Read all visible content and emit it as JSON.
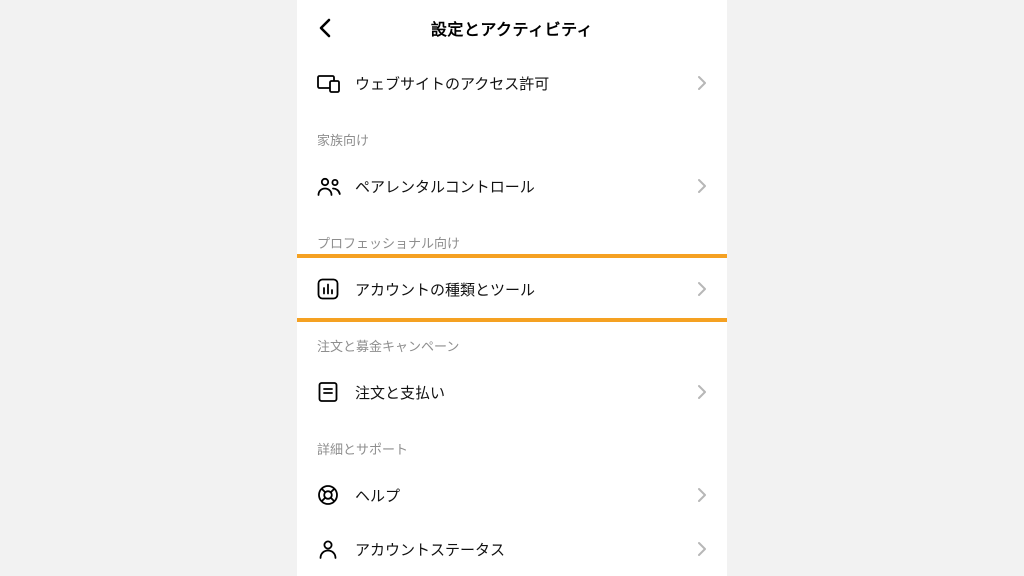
{
  "header": {
    "title": "設定とアクティビティ"
  },
  "rows": {
    "website_permissions": "ウェブサイトのアクセス許可",
    "parental_controls": "ペアレンタルコントロール",
    "account_types_tools": "アカウントの種類とツール",
    "orders_payments": "注文と支払い",
    "help": "ヘルプ",
    "account_status": "アカウントステータス"
  },
  "sections": {
    "family": "家族向け",
    "professionals": "プロフェッショナル向け",
    "orders_fundraising": "注文と募金キャンペーン",
    "details_support": "詳細とサポート"
  }
}
